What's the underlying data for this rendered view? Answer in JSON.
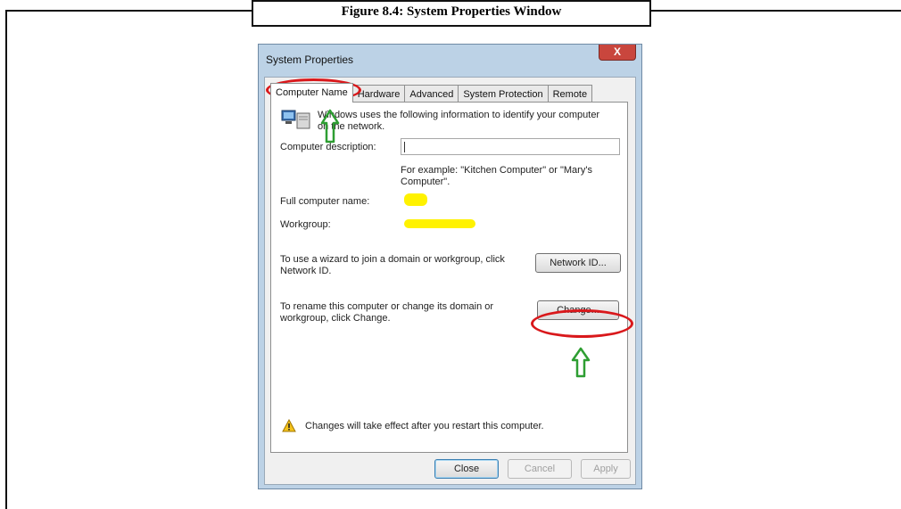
{
  "figure": {
    "caption": "Figure 8.4: System Properties Window"
  },
  "window": {
    "title": "System Properties",
    "close_glyph": "X",
    "tabs": [
      {
        "label": "Computer Name"
      },
      {
        "label": "Hardware"
      },
      {
        "label": "Advanced"
      },
      {
        "label": "System Protection"
      },
      {
        "label": "Remote"
      }
    ],
    "intro_text_line1": "Windows uses the following information to identify your computer",
    "intro_text_line2": "on the network.",
    "description": {
      "label": "Computer description:",
      "value": "",
      "hint_line1": "For example: \"Kitchen Computer\" or \"Mary's",
      "hint_line2": "Computer\"."
    },
    "full_name_label": "Full computer name:",
    "workgroup_label": "Workgroup:",
    "network_id": {
      "text_line1": "To use a wizard to join a domain or workgroup, click",
      "text_line2": "Network ID.",
      "button": "Network ID..."
    },
    "rename": {
      "text_line1": "To rename this computer or change its domain or",
      "text_line2": "workgroup, click Change.",
      "button": "Change..."
    },
    "warning_text": "Changes will take effect after you restart this computer.",
    "buttons": {
      "ok": "Close",
      "cancel": "Cancel",
      "apply": "Apply"
    }
  },
  "colors": {
    "annotation_red": "#d9181b",
    "annotation_green": "#2e9e32",
    "highlight_yellow": "#fff200"
  }
}
